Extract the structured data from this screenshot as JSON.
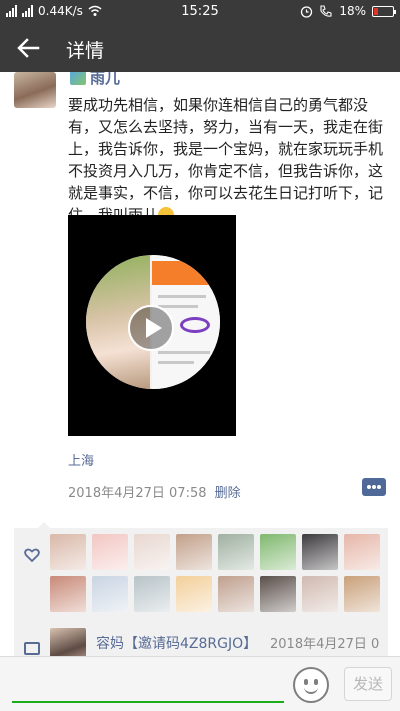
{
  "status_bar": {
    "network": "4G",
    "speed": "0.44K/s",
    "time": "15:25",
    "battery": "18%",
    "icons": [
      "signal-icon",
      "signal-icon",
      "wifi-icon",
      "alarm-icon",
      "call-icon",
      "battery-icon"
    ]
  },
  "nav": {
    "title": "详情"
  },
  "post": {
    "author": "雨儿",
    "text": "要成功先相信，如果你连相信自己的勇气都没有，又怎么去坚持，努力，当有一天，我走在街上，我告诉你，我是一个宝妈，就在家玩玩手机不投资月入几万，你肯定不信，但我告诉你，这就是事实，不信，你可以去花生日记打听下，记住，我叫雨儿",
    "location": "上海",
    "timestamp": "2018年4月27日 07:58",
    "delete_label": "删除"
  },
  "likes": {
    "colors": [
      "#d9b8a8",
      "#f2c6c2",
      "#e8d7cf",
      "#c2a08a",
      "#9fb0a0",
      "#7fb86e",
      "#3d3a3d",
      "#e6b6a8",
      "#c88a78",
      "#c9d4e2",
      "#b7c3c8",
      "#f3cf9a",
      "#bfa08e",
      "#5a4f4a",
      "#d0b9b0",
      "#c9a07a"
    ]
  },
  "comment": {
    "author": "容妈【邀请码4Z8RGJO】",
    "time": "2018年4月27日 0"
  },
  "input": {
    "send_label": "发送"
  }
}
